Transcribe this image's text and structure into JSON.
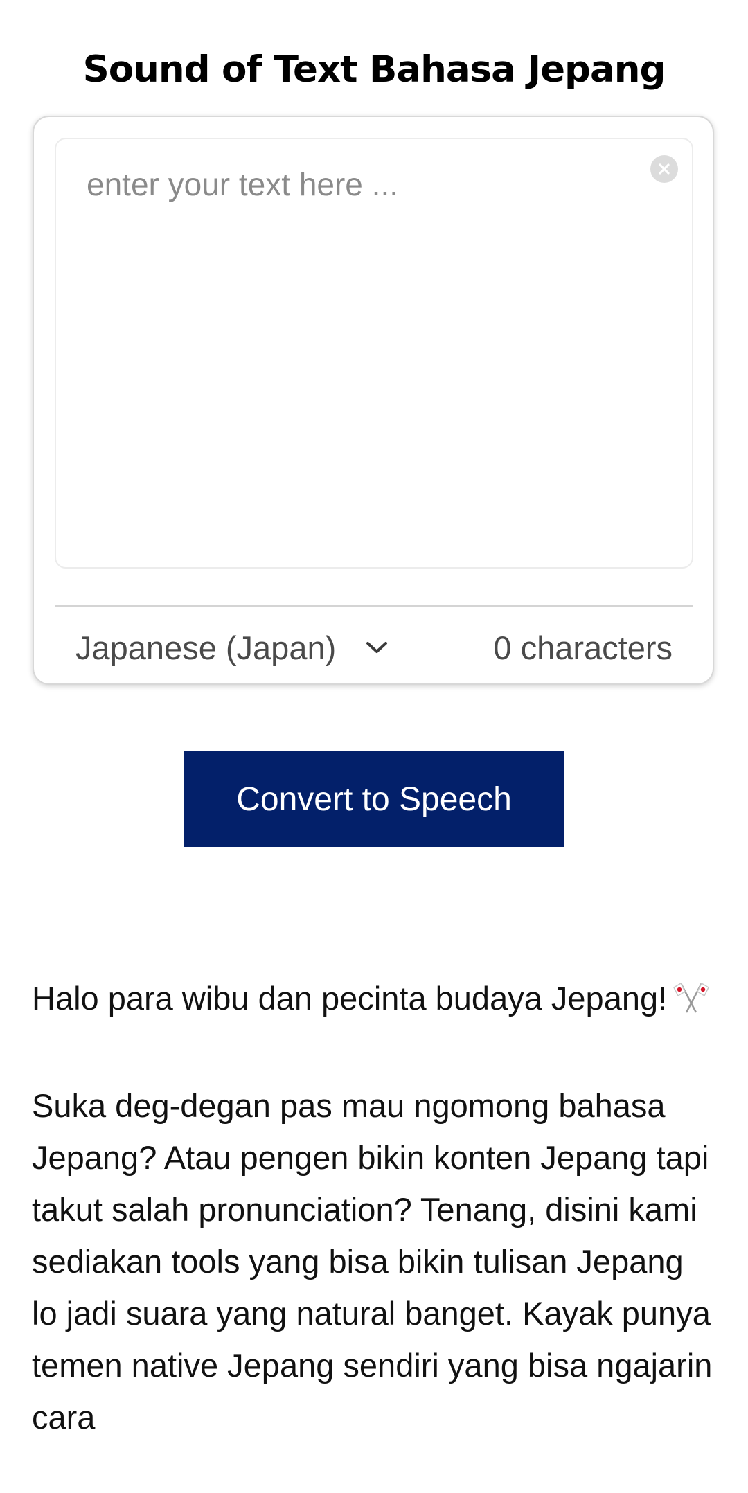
{
  "header": {
    "title": "Sound of Text Bahasa Jepang"
  },
  "editor": {
    "placeholder": "enter your text here ...",
    "value": "",
    "clear_icon": "close-circle-icon",
    "language": "Japanese (Japan)",
    "language_icon": "chevron-down-icon",
    "char_count": "0 characters"
  },
  "actions": {
    "convert_label": "Convert to Speech",
    "convert_color": "#03206a"
  },
  "content": {
    "intro": "Halo para wibu dan pecinta budaya Jepang!",
    "intro_icon": "crossed-japan-flags-icon",
    "paragraph": "Suka deg-degan pas mau ngomong bahasa Jepang? Atau pengen bikin konten Jepang tapi takut salah pronunciation? Tenang, disini kami sediakan tools yang bisa bikin tulisan Jepang lo jadi suara yang natural banget. Kayak punya temen native Jepang sendiri yang bisa ngajarin cara"
  }
}
